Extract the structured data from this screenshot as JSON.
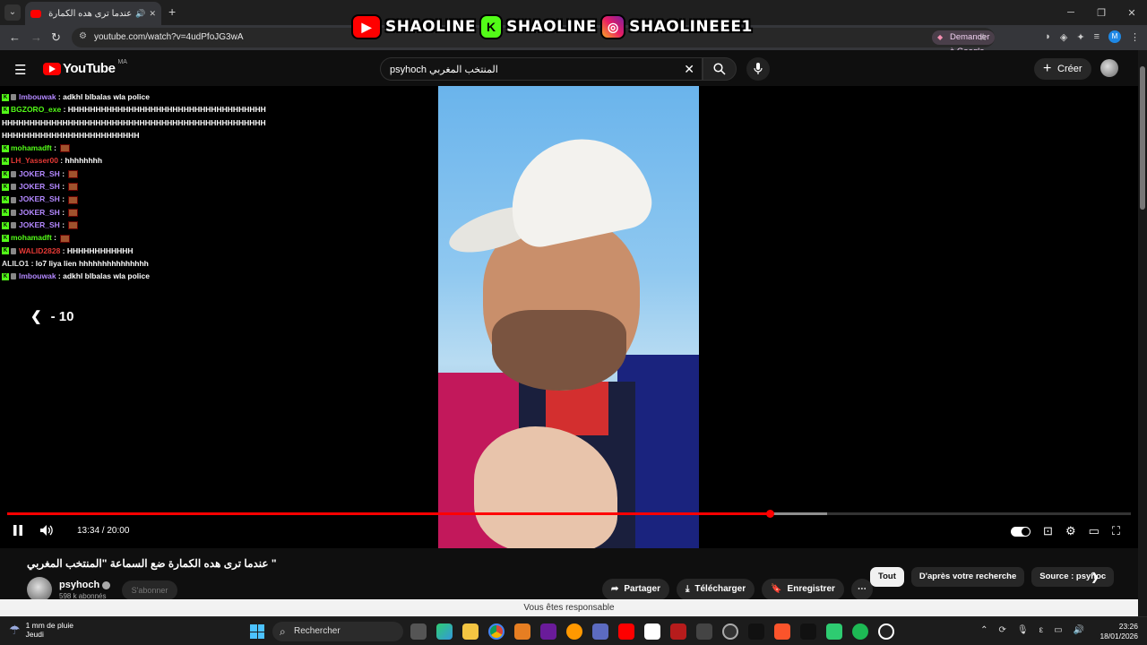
{
  "browser": {
    "tab_title": "عندما ترى هده الكمارة ضع ال...",
    "url": "youtube.com/watch?v=4udPfoJG3wA",
    "ask_google": "Demander à Google"
  },
  "banner": {
    "items": [
      "SHAOLINE",
      "SHAOLINE",
      "SHAOLINEEE1"
    ]
  },
  "youtube": {
    "logo_text": "YouTube",
    "region": "MA",
    "search_value": "psyhoch المنتخب المغربي",
    "create_label": "Créer"
  },
  "chat": [
    {
      "user": "lmbouwak",
      "color": "#b388ff",
      "kick": true,
      "sub": true,
      "text": "adkhl blbalas wla police",
      "emote": false
    },
    {
      "user": "BGZORO_exe",
      "color": "#53fc18",
      "kick": true,
      "sub": false,
      "text": "HHHHHHHHHHHHHHHHHHHHHHHHHHHHHHHHHHHHHHHHHHHHHHHHHHHHHHHHHHHHHHHHHHHHHHHHHHHHHHHHHHHHHHHHHHHHHHHHHHHHHHHHHHHHH",
      "emote": false
    },
    {
      "user": "mohamadft",
      "color": "#53fc18",
      "kick": true,
      "sub": false,
      "text": "",
      "emote": true
    },
    {
      "user": "LH_Yasser00",
      "color": "#e53935",
      "kick": true,
      "sub": false,
      "text": "hhhhhhhh",
      "emote": false
    },
    {
      "user": "JOKER_SH",
      "color": "#b388ff",
      "kick": true,
      "sub": true,
      "text": "",
      "emote": true
    },
    {
      "user": "JOKER_SH",
      "color": "#b388ff",
      "kick": true,
      "sub": true,
      "text": "",
      "emote": true
    },
    {
      "user": "JOKER_SH",
      "color": "#b388ff",
      "kick": true,
      "sub": true,
      "text": "",
      "emote": true
    },
    {
      "user": "JOKER_SH",
      "color": "#b388ff",
      "kick": true,
      "sub": true,
      "text": "",
      "emote": true
    },
    {
      "user": "JOKER_SH",
      "color": "#b388ff",
      "kick": true,
      "sub": true,
      "text": "",
      "emote": true
    },
    {
      "user": "mohamadft",
      "color": "#53fc18",
      "kick": true,
      "sub": false,
      "text": "",
      "emote": true
    },
    {
      "user": "WALID2828",
      "color": "#e53935",
      "kick": true,
      "sub": true,
      "text": "HHHHHHHHHHHH",
      "emote": false
    },
    {
      "user": "ALILO1",
      "color": "#e0e0e0",
      "kick": false,
      "sub": false,
      "text": "lo7 liya lien hhhhhhhhhhhhhhh",
      "emote": false
    },
    {
      "user": "lmbouwak",
      "color": "#b388ff",
      "kick": true,
      "sub": true,
      "text": "adkhl blbalas wla police",
      "emote": false
    }
  ],
  "player": {
    "seek_back": "- 10",
    "time": "13:34 / 20:00",
    "progress": 0.6785,
    "buffered": 0.73
  },
  "video": {
    "title": "\" عندما ترى هده الكمارة ضع السماعة \"المنتخب المغربي",
    "channel": "psyhoch",
    "subscribers": "598 k abonnés",
    "subscribe_label": "S'abonner",
    "actions": [
      "Partager",
      "Télécharger",
      "Enregistrer"
    ],
    "chips": [
      "Tout",
      "D'après votre recherche",
      "Source : psyhoc"
    ]
  },
  "toast": "Vous êtes responsable",
  "taskbar": {
    "weather_line1": "1 mm de pluie",
    "weather_line2": "Jeudi",
    "search_label": "Rechercher",
    "time": "23:26",
    "date": "18/01/2026",
    "ime": "ε"
  }
}
